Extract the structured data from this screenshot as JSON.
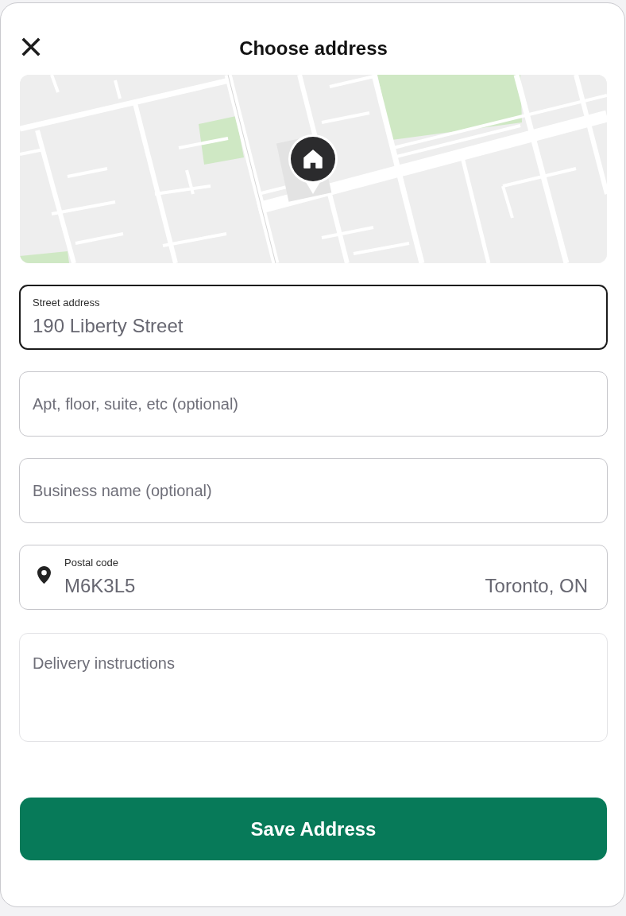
{
  "header": {
    "title": "Choose address"
  },
  "fields": [
    {
      "kind": "text",
      "label": "Street address",
      "value": "190 Liberty Street",
      "focused": true
    },
    {
      "kind": "text",
      "placeholder": "Apt, floor, suite, etc (optional)",
      "focused": false
    },
    {
      "kind": "text",
      "placeholder": "Business name (optional)",
      "focused": false
    },
    {
      "kind": "postal",
      "label": "Postal code",
      "value": "M6K3L5",
      "suffix": "Toronto, ON",
      "focused": false
    },
    {
      "kind": "textarea",
      "placeholder": "Delivery instructions",
      "focused": false
    }
  ],
  "save_button": {
    "label": "Save Address"
  }
}
